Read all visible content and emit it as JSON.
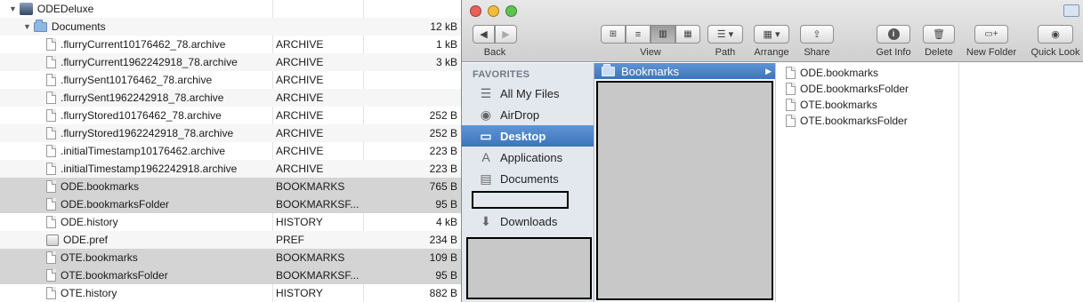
{
  "file_list": {
    "rows": [
      {
        "name": "ODEDeluxe",
        "kind": "",
        "size": "",
        "icon": "app-icon",
        "indent": 0,
        "disclosure": "▼"
      },
      {
        "name": "Documents",
        "kind": "",
        "size": "12 kB",
        "icon": "folder-icon",
        "indent": 1,
        "disclosure": "▼"
      },
      {
        "name": ".flurryCurrent10176462_78.archive",
        "kind": "ARCHIVE",
        "size": "1 kB",
        "icon": "document-icon",
        "indent": 2
      },
      {
        "name": ".flurryCurrent1962242918_78.archive",
        "kind": "ARCHIVE",
        "size": "3 kB",
        "icon": "document-icon",
        "indent": 2
      },
      {
        "name": ".flurrySent10176462_78.archive",
        "kind": "ARCHIVE",
        "size": "",
        "icon": "document-icon",
        "indent": 2
      },
      {
        "name": ".flurrySent1962242918_78.archive",
        "kind": "ARCHIVE",
        "size": "",
        "icon": "document-icon",
        "indent": 2
      },
      {
        "name": ".flurryStored10176462_78.archive",
        "kind": "ARCHIVE",
        "size": "252 B",
        "icon": "document-icon",
        "indent": 2
      },
      {
        "name": ".flurryStored1962242918_78.archive",
        "kind": "ARCHIVE",
        "size": "252 B",
        "icon": "document-icon",
        "indent": 2
      },
      {
        "name": ".initialTimestamp10176462.archive",
        "kind": "ARCHIVE",
        "size": "223 B",
        "icon": "document-icon",
        "indent": 2
      },
      {
        "name": ".initialTimestamp1962242918.archive",
        "kind": "ARCHIVE",
        "size": "223 B",
        "icon": "document-icon",
        "indent": 2
      },
      {
        "name": "ODE.bookmarks",
        "kind": "BOOKMARKS",
        "size": "765 B",
        "icon": "document-icon",
        "indent": 2,
        "selected": true
      },
      {
        "name": "ODE.bookmarksFolder",
        "kind": "BOOKMARKSF...",
        "size": "95 B",
        "icon": "document-icon",
        "indent": 2,
        "selected": true
      },
      {
        "name": "ODE.history",
        "kind": "HISTORY",
        "size": "4 kB",
        "icon": "document-icon",
        "indent": 2
      },
      {
        "name": "ODE.pref",
        "kind": "PREF",
        "size": "234 B",
        "icon": "pref-image-icon",
        "indent": 2
      },
      {
        "name": "OTE.bookmarks",
        "kind": "BOOKMARKS",
        "size": "109 B",
        "icon": "document-icon",
        "indent": 2,
        "selected": true
      },
      {
        "name": "OTE.bookmarksFolder",
        "kind": "BOOKMARKSF...",
        "size": "95 B",
        "icon": "document-icon",
        "indent": 2,
        "selected": true
      },
      {
        "name": "OTE.history",
        "kind": "HISTORY",
        "size": "882 B",
        "icon": "document-icon",
        "indent": 2
      }
    ]
  },
  "finder": {
    "toolbar": {
      "back_label": "Back",
      "view_label": "View",
      "path_label": "Path",
      "arrange_label": "Arrange",
      "share_label": "Share",
      "get_info_label": "Get Info",
      "delete_label": "Delete",
      "new_folder_label": "New Folder",
      "quick_look_label": "Quick Look",
      "back_glyph": "◀",
      "forward_glyph": "▶"
    },
    "sidebar": {
      "heading": "FAVORITES",
      "items": [
        {
          "label": "All My Files",
          "icon": "all-files-icon",
          "glyph": "☰"
        },
        {
          "label": "AirDrop",
          "icon": "airdrop-icon",
          "glyph": "◉"
        },
        {
          "label": "Desktop",
          "icon": "desktop-icon",
          "glyph": "▭",
          "selected": true
        },
        {
          "label": "Applications",
          "icon": "applications-icon",
          "glyph": "A"
        },
        {
          "label": "Documents",
          "icon": "documents-icon",
          "glyph": "▤"
        },
        {
          "label": "Downloads",
          "icon": "downloads-icon",
          "glyph": "⬇"
        }
      ]
    },
    "column1": {
      "selected_label": "Bookmarks",
      "arrow": "▶"
    },
    "column2": {
      "items": [
        "ODE.bookmarks",
        "ODE.bookmarksFolder",
        "OTE.bookmarks",
        "OTE.bookmarksFolder"
      ]
    }
  },
  "colors": {
    "selection_blue": "#3d74bd",
    "sidebar_bg": "#e3e8ee",
    "row_selected": "#d4d4d4",
    "redaction_gray": "#c8c8c8",
    "traffic_red": "#ec5f56",
    "traffic_yellow": "#f2bc3c",
    "traffic_green": "#5ec44f"
  }
}
